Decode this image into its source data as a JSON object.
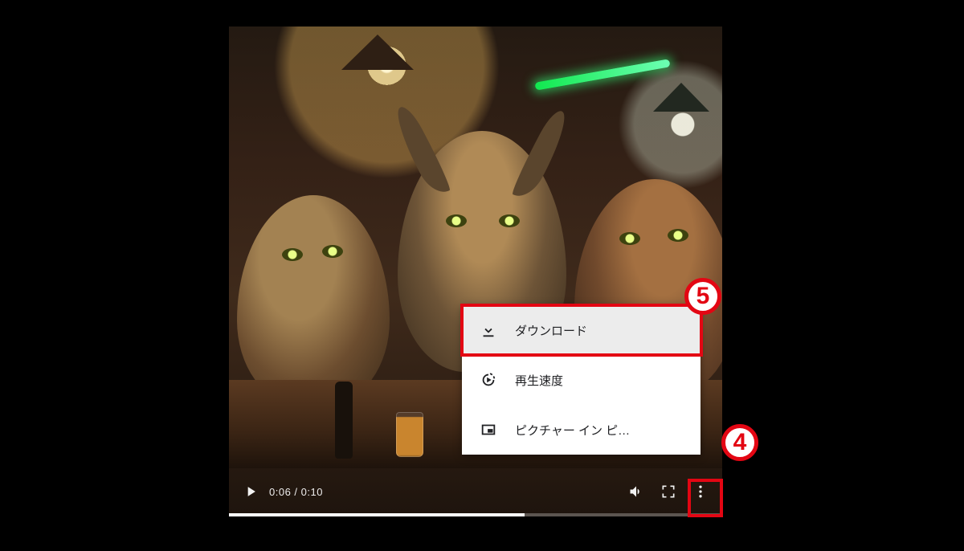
{
  "player": {
    "current_time": "0:06",
    "total_time": "0:10",
    "time_display": "0:06 / 0:10",
    "progress_percent": 60
  },
  "menu": {
    "items": [
      {
        "label": "ダウンロード",
        "icon": "download-icon",
        "active": true
      },
      {
        "label": "再生速度",
        "icon": "playback-speed-icon",
        "active": false
      },
      {
        "label": "ピクチャー イン ピ…",
        "icon": "picture-in-picture-icon",
        "active": false
      }
    ]
  },
  "annotations": {
    "more_button": "4",
    "download_item": "5"
  },
  "colors": {
    "callout": "#e30613",
    "menu_bg": "#ffffff",
    "menu_active_bg": "#ececec"
  }
}
